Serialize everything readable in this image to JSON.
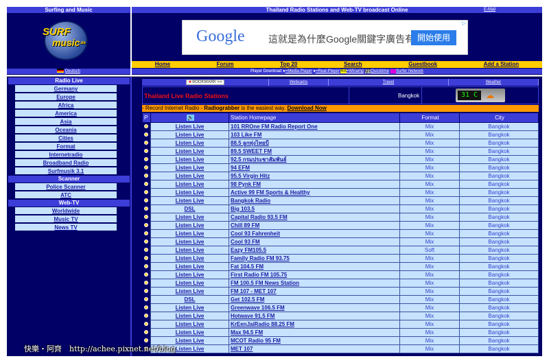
{
  "header": {
    "left_title": "Surfing and Music",
    "title": "Thailand Radio Stations and Web-TV broadcast Online",
    "email": "E-Mail"
  },
  "logo": {
    "line1": "SURF",
    "line2": "music",
    "suffix": ".de"
  },
  "ad": {
    "brand": "Google",
    "text": "這就是為什麼Google關鍵字廣告有效",
    "button": "開始使用"
  },
  "nav": [
    "Home",
    "Forum",
    "Top 20",
    "Search",
    "Guestbook",
    "Add a Station"
  ],
  "language": "Deutsch",
  "players": {
    "label": "Player Download",
    "items": [
      "=Media-Player",
      "=Real-Player",
      "=Winamp",
      "Quicktime",
      "Surfer Network"
    ],
    "badges": [
      "RA",
      "QT",
      "SN"
    ]
  },
  "sidebar": {
    "sections": [
      {
        "title": "Radio Live",
        "items": [
          "Germany",
          "Europe",
          "Africa",
          "America",
          "Asia",
          "Oceania",
          "Cities",
          "Format",
          "Internetradio",
          "Broadband Radio",
          "Surfmusik 3.1"
        ]
      },
      {
        "title": "Scanner",
        "items": [
          "Police Scanner",
          "ATC"
        ]
      },
      {
        "title": "Web-TV",
        "items": [
          "Worldwide",
          "Music TV",
          "News TV"
        ]
      }
    ]
  },
  "tabs": {
    "bookmark": "BOOKMARK",
    "items": [
      "Webcams",
      "Travel",
      "Weather"
    ]
  },
  "page_title": "Thailand Live Radio Stations",
  "weather": {
    "city": "Bangkok",
    "temp": "31 C"
  },
  "promo": {
    "prefix": "- Record Internet Radio - ",
    "product": "Radiograbber",
    "middle": " is the easiest way. ",
    "link": "Download Now"
  },
  "table": {
    "headers": {
      "p": "P",
      "station": "Station Homepage",
      "format": "Format",
      "city": "City"
    },
    "rows": [
      [
        "Listen Live",
        "101 RROne FM Radio Report One",
        "Mix",
        "Bangkok"
      ],
      [
        "Listen Live",
        "103 Like FM",
        "Mix",
        "Bangkok"
      ],
      [
        "Listen Live",
        "88.5 ลูกทุ่งไทยบี",
        "Mix",
        "Bangkok"
      ],
      [
        "Listen Live",
        "89.5 SWEET FM",
        "Mix",
        "Bangkok"
      ],
      [
        "Listen Live",
        "92.5 กรมประชาสัมพันธ์",
        "Mix",
        "Bangkok"
      ],
      [
        "Listen Live",
        "94 EFM",
        "Mix",
        "Bangkok"
      ],
      [
        "Listen Live",
        "95.5 Virgin Hitz",
        "Mix",
        "Bangkok"
      ],
      [
        "Listen Live",
        "98 Pynk FM",
        "Mix",
        "Bangkok"
      ],
      [
        "Listen Live",
        "Active 99 FM Sports & Healthy",
        "Mix",
        "Bangkok"
      ],
      [
        "Listen Live",
        "Bangkok Radio",
        "Mix",
        "Bangkok"
      ],
      [
        "DSL",
        "Big 103.5",
        "Mix",
        "Bangkok"
      ],
      [
        "Listen Live",
        "Capital Radio 93.5 FM",
        "Mix",
        "Bangkok"
      ],
      [
        "Listen Live",
        "Chill 89 FM",
        "Mix",
        "Bangkok"
      ],
      [
        "Listen Live",
        "Cool 93 Fahrenheit",
        "Mix",
        "Bangkok"
      ],
      [
        "Listen Live",
        "Cool 93 FM",
        "Mix",
        "Bangkok"
      ],
      [
        "Listen Live",
        "Eazy FM105.5",
        "Soft",
        "Bangkok"
      ],
      [
        "Listen Live",
        "Family Radio FM 93.75",
        "Mix",
        "Bangkok"
      ],
      [
        "Listen Live",
        "Fat 104.5 FM",
        "Mix",
        "Bangkok"
      ],
      [
        "Listen Live",
        "First Radio FM 105.75",
        "Mix",
        "Bangkok"
      ],
      [
        "Listen Live",
        "FM 100.5 FM News Station",
        "Mix",
        "Bangkok"
      ],
      [
        "Listen Live",
        "FM 107 - MET 107",
        "Mix",
        "Bangkok"
      ],
      [
        "DSL",
        "Get 102.5 FM",
        "Mix",
        "Bangkok"
      ],
      [
        "Listen Live",
        "Greenwave 106.5 FM",
        "Mix",
        "Bangkok"
      ],
      [
        "Listen Live",
        "Hotwave 91.5 FM",
        "Mix",
        "Bangkok"
      ],
      [
        "Listen Live",
        "KrEenJaiRadio 88.25 FM",
        "Mix",
        "Bangkok"
      ],
      [
        "Listen Live",
        "Max 94.5 FM",
        "Mix",
        "Bangkok"
      ],
      [
        "Listen Live",
        "MCOT Radio 95 FM",
        "Mix",
        "Bangkok"
      ],
      [
        "Listen Live",
        "MET 107",
        "Mix",
        "Bangkok"
      ]
    ]
  },
  "watermark": "快樂・阿齊　http://achee.pixnet.net/blog"
}
